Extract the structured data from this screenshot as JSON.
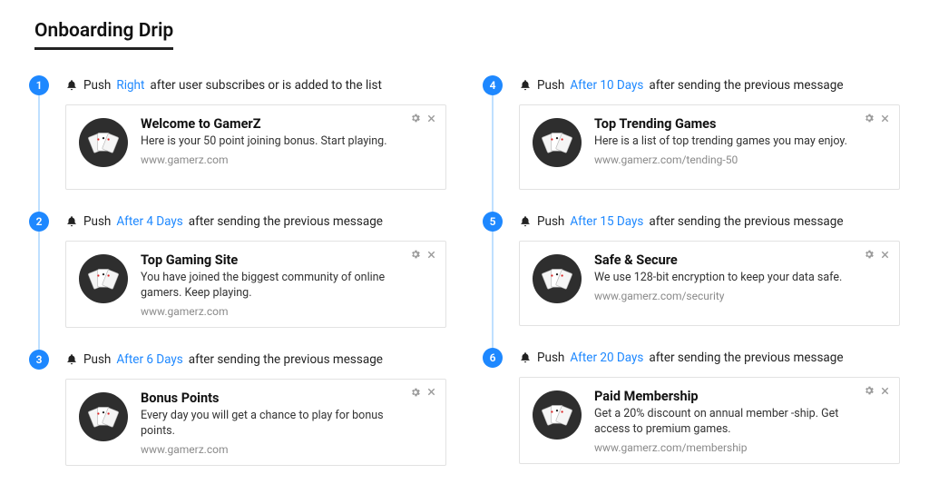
{
  "title": "Onboarding Drip",
  "push_prefix": "Push",
  "first_suffix": "after user subscribes or is added to the list",
  "later_suffix": "after sending the previous message",
  "steps": [
    {
      "num": "1",
      "timing": "Right",
      "suffix_key": "first_suffix",
      "card": {
        "title": "Welcome to GamerZ",
        "desc": "Here is your 50 point joining bonus. Start playing.",
        "url": "www.gamerz.com"
      }
    },
    {
      "num": "2",
      "timing": "After 4 Days",
      "suffix_key": "later_suffix",
      "card": {
        "title": "Top Gaming Site",
        "desc": "You have joined the biggest community of online gamers. Keep playing.",
        "url": "www.gamerz.com"
      }
    },
    {
      "num": "3",
      "timing": "After 6 Days",
      "suffix_key": "later_suffix",
      "card": {
        "title": "Bonus Points",
        "desc": "Every day you will get a chance to play for bonus points.",
        "url": "www.gamerz.com"
      }
    },
    {
      "num": "4",
      "timing": "After 10 Days",
      "suffix_key": "later_suffix",
      "card": {
        "title": "Top Trending Games",
        "desc": "Here is a list of top trending games you may enjoy.",
        "url": "www.gamerz.com/tending-50"
      }
    },
    {
      "num": "5",
      "timing": "After 15 Days",
      "suffix_key": "later_suffix",
      "card": {
        "title": "Safe & Secure",
        "desc": "We use 128-bit encryption to keep your data safe.",
        "url": "www.gamerz.com/security"
      }
    },
    {
      "num": "6",
      "timing": "After 20 Days",
      "suffix_key": "later_suffix",
      "card": {
        "title": "Paid Membership",
        "desc": "Get a 20% discount on annual member -ship. Get access to premium games.",
        "url": "www.gamerz.com/membership"
      }
    }
  ]
}
